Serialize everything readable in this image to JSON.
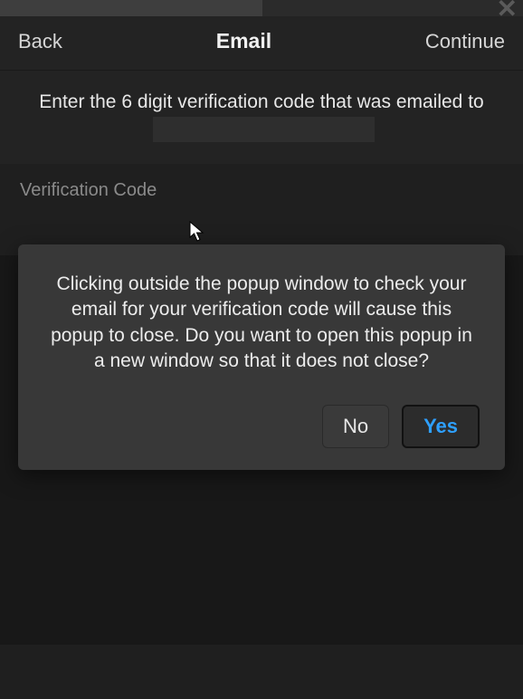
{
  "header": {
    "back_label": "Back",
    "title": "Email",
    "continue_label": "Continue"
  },
  "instruction": {
    "prefix": "Enter the 6 digit verification code that was emailed to ",
    "email_redacted": true
  },
  "form": {
    "vcode_label": "Verification Code"
  },
  "modal": {
    "message": "Clicking outside the popup window to check your email for your verification code will cause this popup to close. Do you want to open this popup in a new window so that it does not close?",
    "no_label": "No",
    "yes_label": "Yes"
  }
}
